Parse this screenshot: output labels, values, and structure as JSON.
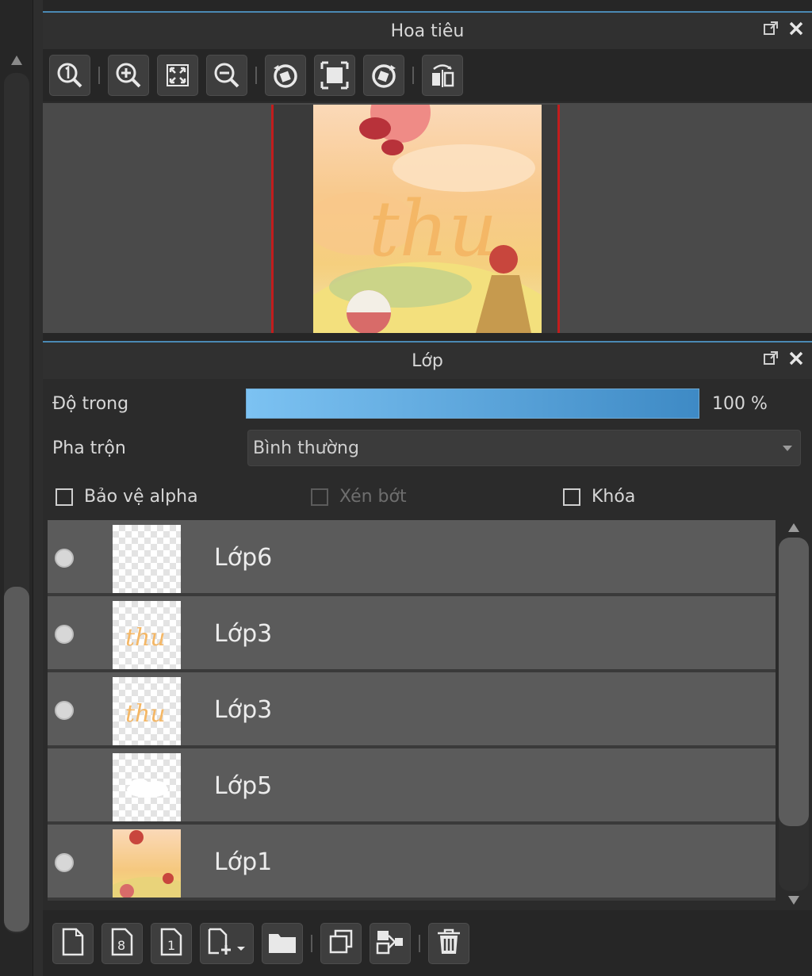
{
  "navigator": {
    "title": "Hoa tiêu",
    "tools": [
      {
        "icon": "zoom-actual-icon"
      },
      {
        "icon": "zoom-in-icon"
      },
      {
        "icon": "fit-screen-icon"
      },
      {
        "icon": "zoom-out-icon"
      },
      {
        "icon": "rotate-left-icon"
      },
      {
        "icon": "fit-window-icon"
      },
      {
        "icon": "rotate-right-icon"
      },
      {
        "icon": "flip-horizontal-icon"
      }
    ]
  },
  "layers": {
    "title": "Lớp",
    "opacity_label": "Độ trong",
    "opacity_value": "100 %",
    "opacity_fraction": 1.0,
    "blend_label": "Pha trộn",
    "blend_value": "Bình thường",
    "protect_alpha_label": "Bảo vệ alpha",
    "clipping_label": "Xén bớt",
    "lock_label": "Khóa",
    "items": [
      {
        "name": "Lớp6",
        "visible": true,
        "thumb": "empty"
      },
      {
        "name": "Lớp3",
        "visible": true,
        "thumb": "text"
      },
      {
        "name": "Lớp3",
        "visible": true,
        "thumb": "text"
      },
      {
        "name": "Lớp5",
        "visible": false,
        "thumb": "cloud"
      },
      {
        "name": "Lớp1",
        "visible": true,
        "thumb": "art"
      }
    ],
    "thumb_text": "thu",
    "bottom_tools": [
      {
        "icon": "new-layer-icon"
      },
      {
        "icon": "new-8bit-layer-icon"
      },
      {
        "icon": "new-1bit-layer-icon"
      },
      {
        "icon": "add-layer-menu-icon"
      },
      {
        "icon": "folder-icon"
      },
      {
        "icon": "duplicate-layer-icon"
      },
      {
        "icon": "merge-down-icon"
      },
      {
        "icon": "delete-layer-icon"
      }
    ]
  },
  "colors": {
    "accent": "#4a89b4",
    "frame": "#c21d1d",
    "opacity_start": "#7cc2f2",
    "opacity_end": "#3e8ac5"
  }
}
